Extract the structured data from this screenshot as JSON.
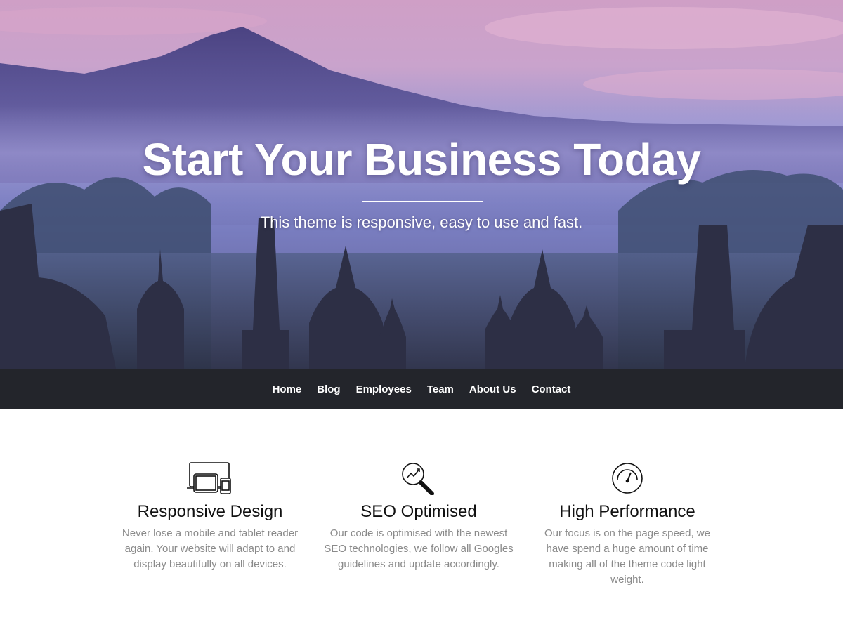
{
  "hero": {
    "title": "Start Your Business Today",
    "subtitle": "This theme is responsive, easy to use and fast."
  },
  "nav": {
    "items": [
      {
        "label": "Home"
      },
      {
        "label": "Blog"
      },
      {
        "label": "Employees"
      },
      {
        "label": "Team"
      },
      {
        "label": "About Us"
      },
      {
        "label": "Contact"
      }
    ]
  },
  "features": [
    {
      "icon": "devices-icon",
      "title": "Responsive Design",
      "text": "Never lose a mobile and tablet reader again. Your website will adapt to and display beautifully on all devices."
    },
    {
      "icon": "magnifier-chart-icon",
      "title": "SEO Optimised",
      "text": "Our code is optimised with the newest SEO technologies, we follow all Googles guidelines and update accordingly."
    },
    {
      "icon": "speedometer-icon",
      "title": "High Performance",
      "text": "Our focus is on the page speed, we have spend a huge amount of time making all of the theme code light weight."
    }
  ],
  "colors": {
    "nav_background": "#23252b",
    "hero_text": "#ffffff",
    "feature_text": "#8a8a8a"
  }
}
